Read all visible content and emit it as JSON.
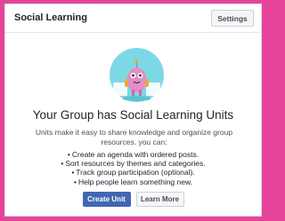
{
  "header": {
    "title": "Social Learning",
    "settings_label": "Settings"
  },
  "illustration": {
    "icon": "robot-mascot-icon",
    "colors": {
      "circle": "#7dd8e6",
      "body": "#e38ec4",
      "accent": "#f2a33a"
    }
  },
  "main": {
    "headline": "Your Group has Social Learning Units",
    "description_line1": "Units make it easy to share knowledge and organize group",
    "description_line2": "resources. you can:",
    "bullets": [
      "Create an agenda with ordered posts.",
      "Sort resources by themes and categories.",
      "Track group participation (optional).",
      "Help people learn something new."
    ]
  },
  "actions": {
    "create_label": "Create Unit",
    "learn_more_label": "Learn More"
  },
  "colors": {
    "page_border": "#e5449a",
    "primary_button": "#4267b2"
  }
}
